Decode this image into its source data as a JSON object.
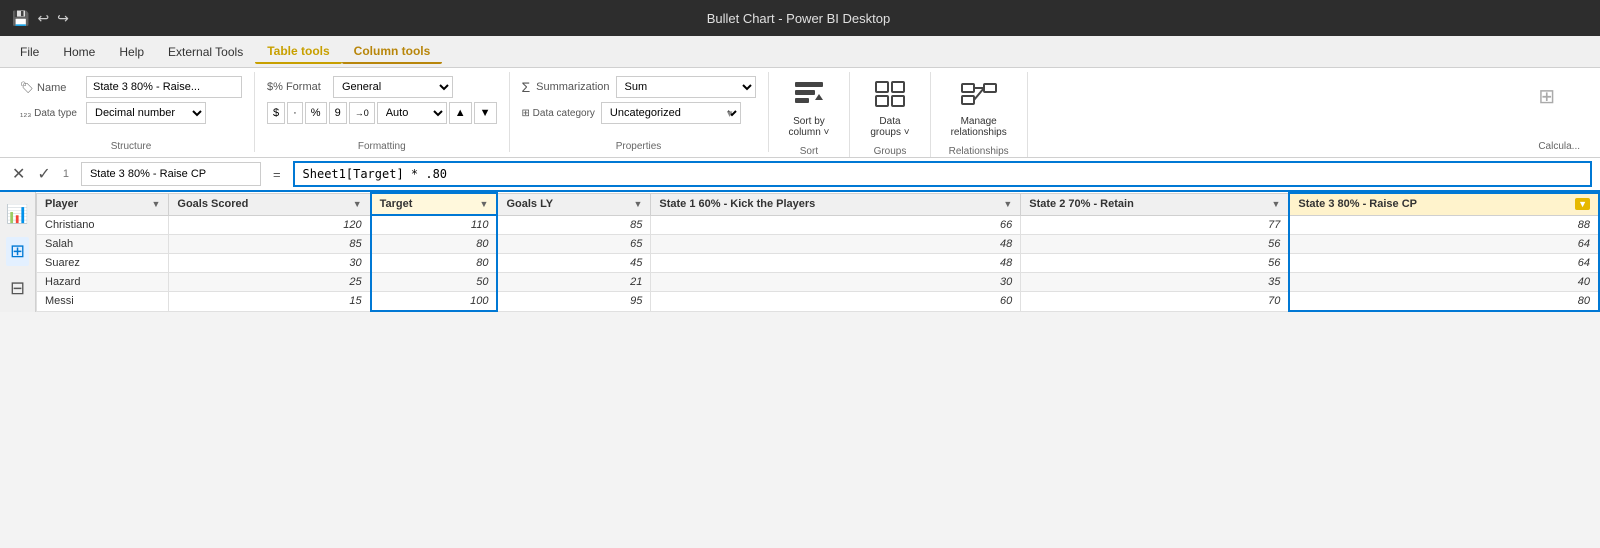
{
  "titleBar": {
    "title": "Bullet Chart - Power BI Desktop",
    "icons": [
      "💾",
      "↩",
      "↪"
    ]
  },
  "menuBar": {
    "items": [
      {
        "label": "File",
        "active": false
      },
      {
        "label": "Home",
        "active": false
      },
      {
        "label": "Help",
        "active": false
      },
      {
        "label": "External Tools",
        "active": false
      },
      {
        "label": "Table tools",
        "active": true,
        "style": "gold"
      },
      {
        "label": "Column tools",
        "active": true,
        "style": "gold"
      }
    ]
  },
  "ribbon": {
    "groups": [
      {
        "label": "Structure",
        "nameLabel": "Name",
        "nameValue": "State 3 80% - Raise...",
        "dataTypeLabel": "Data type",
        "dataTypeValue": "Decimal number"
      },
      {
        "label": "Formatting",
        "formatLabel": "$% Format",
        "formatValue": "General",
        "autoLabel": "Auto",
        "symbols": [
          "$",
          "·",
          "%",
          "9",
          "→0"
        ]
      },
      {
        "label": "Properties",
        "summarizationLabel": "Summarization",
        "summarizationValue": "Sum",
        "dataCategoryLabel": "Data category",
        "dataCategoryValue": "Uncategorized"
      },
      {
        "label": "Sort",
        "sortByColumnLabel": "Sort by\ncolumn ˅",
        "sortByColumnIcon": "⊞↕"
      },
      {
        "label": "Groups",
        "dataGroupsLabel": "Data\ngroups ˅",
        "dataGroupsIcon": "⊞⊞"
      },
      {
        "label": "Relationships",
        "manageLabel": "Manage\nrelationships",
        "manageIcon": "⊞⊞"
      }
    ]
  },
  "formulaBar": {
    "number": "1",
    "name": "State 3 80% - Raise CP",
    "expression": "Sheet1[Target] * .80"
  },
  "table": {
    "columns": [
      {
        "label": "Player",
        "highlight": false,
        "targetBorder": false
      },
      {
        "label": "Goals Scored",
        "highlight": false,
        "targetBorder": false
      },
      {
        "label": "Target",
        "highlight": false,
        "targetBorder": true
      },
      {
        "label": "Goals LY",
        "highlight": false,
        "targetBorder": false
      },
      {
        "label": "State 1 60% - Kick the Players",
        "highlight": false,
        "targetBorder": false
      },
      {
        "label": "State 2 70% - Retain",
        "highlight": false,
        "targetBorder": false
      },
      {
        "label": "State 3 80% - Raise CP",
        "highlight": true,
        "targetBorder": false
      }
    ],
    "rows": [
      {
        "player": "Christiano",
        "goals": "120",
        "target": "110",
        "goalsLY": "85",
        "state1": "66",
        "state2": "77",
        "state3": "88"
      },
      {
        "player": "Salah",
        "goals": "85",
        "target": "80",
        "goalsLY": "65",
        "state1": "48",
        "state2": "56",
        "state3": "64"
      },
      {
        "player": "Suarez",
        "goals": "30",
        "target": "80",
        "goalsLY": "45",
        "state1": "48",
        "state2": "56",
        "state3": "64"
      },
      {
        "player": "Hazard",
        "goals": "25",
        "target": "50",
        "goalsLY": "21",
        "state1": "30",
        "state2": "35",
        "state3": "40"
      },
      {
        "player": "Messi",
        "goals": "15",
        "target": "100",
        "goalsLY": "95",
        "state1": "60",
        "state2": "70",
        "state3": "80"
      }
    ]
  },
  "leftPanel": {
    "icons": [
      "📊",
      "⊞",
      "⊞⊞"
    ]
  }
}
